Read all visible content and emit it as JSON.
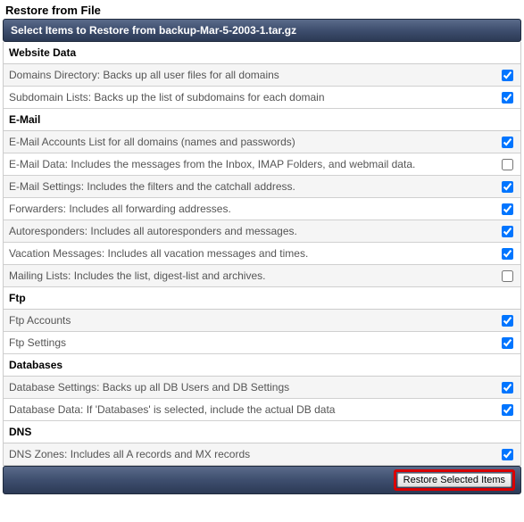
{
  "page_title": "Restore from File",
  "banner": "Select Items to Restore from backup-Mar-5-2003-1.tar.gz",
  "sections": [
    {
      "title": "Website Data",
      "items": [
        {
          "label": "Domains Directory: Backs up all user files for all domains",
          "checked": true
        },
        {
          "label": "Subdomain Lists: Backs up the list of subdomains for each domain",
          "checked": true
        }
      ]
    },
    {
      "title": "E-Mail",
      "items": [
        {
          "label": "E-Mail Accounts List for all domains (names and passwords)",
          "checked": true
        },
        {
          "label": "E-Mail Data: Includes the messages from the Inbox, IMAP Folders, and webmail data.",
          "checked": false
        },
        {
          "label": "E-Mail Settings: Includes the filters and the catchall address.",
          "checked": true
        },
        {
          "label": "Forwarders: Includes all forwarding addresses.",
          "checked": true
        },
        {
          "label": "Autoresponders: Includes all autoresponders and messages.",
          "checked": true
        },
        {
          "label": "Vacation Messages: Includes all vacation messages and times.",
          "checked": true
        },
        {
          "label": "Mailing Lists: Includes the list, digest-list and archives.",
          "checked": false
        }
      ]
    },
    {
      "title": "Ftp",
      "items": [
        {
          "label": "Ftp Accounts",
          "checked": true
        },
        {
          "label": "Ftp Settings",
          "checked": true
        }
      ]
    },
    {
      "title": "Databases",
      "items": [
        {
          "label": "Database Settings: Backs up all DB Users and DB Settings",
          "checked": true
        },
        {
          "label": "Database Data: If 'Databases' is selected, include the actual DB data",
          "checked": true
        }
      ]
    },
    {
      "title": "DNS",
      "items": [
        {
          "label": "DNS Zones: Includes all A records and MX records",
          "checked": true
        }
      ]
    }
  ],
  "restore_button": "Restore Selected Items"
}
